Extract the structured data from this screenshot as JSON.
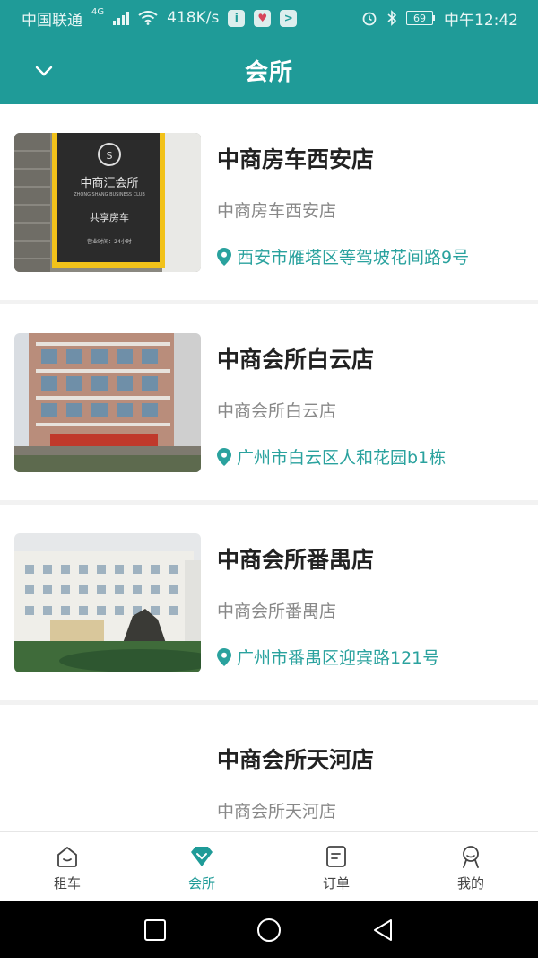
{
  "status_bar": {
    "carrier": "中国联通",
    "network": "4G",
    "speed": "418K/s",
    "battery": "69",
    "time": "中午12:42"
  },
  "header": {
    "title": "会所"
  },
  "stores": [
    {
      "name": "中商房车西安店",
      "subtitle": "中商房车西安店",
      "address": "西安市雁塔区等驾坡花间路9号",
      "image_text": "中商汇会所",
      "image_text_en": "ZHONG SHANG BUSINESS CLUB",
      "sign_text": "共享房车",
      "hours_text": "营业时间：24小时"
    },
    {
      "name": "中商会所白云店",
      "subtitle": "中商会所白云店",
      "address": "广州市白云区人和花园b1栋"
    },
    {
      "name": "中商会所番禺店",
      "subtitle": "中商会所番禺店",
      "address": "广州市番禺区迎宾路121号"
    },
    {
      "name": "中商会所天河店",
      "subtitle": "中商会所天河店"
    }
  ],
  "tabs": [
    {
      "label": "租车",
      "icon": "home-icon",
      "active": false
    },
    {
      "label": "会所",
      "icon": "diamond-icon",
      "active": true
    },
    {
      "label": "订单",
      "icon": "order-icon",
      "active": false
    },
    {
      "label": "我的",
      "icon": "user-icon",
      "active": false
    }
  ],
  "colors": {
    "primary": "#1f9b98",
    "accent_text": "#2aa29e"
  }
}
